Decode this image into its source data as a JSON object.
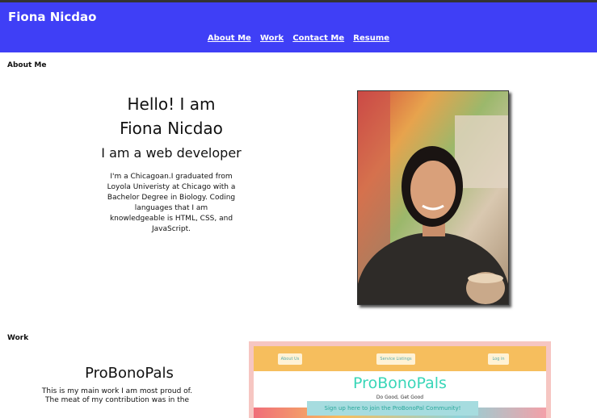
{
  "header": {
    "brand": "Fiona Nicdao",
    "nav": [
      "About Me",
      "Work",
      "Contact Me",
      "Resume"
    ]
  },
  "about": {
    "section_label": "About Me",
    "greeting_line1": "Hello! I am",
    "greeting_line2": "Fiona Nicdao",
    "subtitle": "I am a web developer",
    "bio": "I'm a Chicagoan.I graduated from Loyola Univeristy at Chicago with a Bachelor Degree in Biology. Coding languages that I am knowledgeable is HTML, CSS, and JavaScript."
  },
  "work": {
    "section_label": "Work",
    "title": "ProBonoPals",
    "desc_line1": "This is my main work I am most proud of.",
    "desc_line2": "The meat of my contribution was in the",
    "screenshot": {
      "nav": [
        "About Us",
        "Service Listings",
        "Log in"
      ],
      "title": "ProBonoPals",
      "tagline": "Do Good, Get Good",
      "cta": "Sign up here to join the ProBonoPal Community!"
    }
  },
  "colors": {
    "header_bg": "#3f3ff6",
    "accent_teal": "#39d6b8",
    "nav_orange": "#f6be5d"
  }
}
